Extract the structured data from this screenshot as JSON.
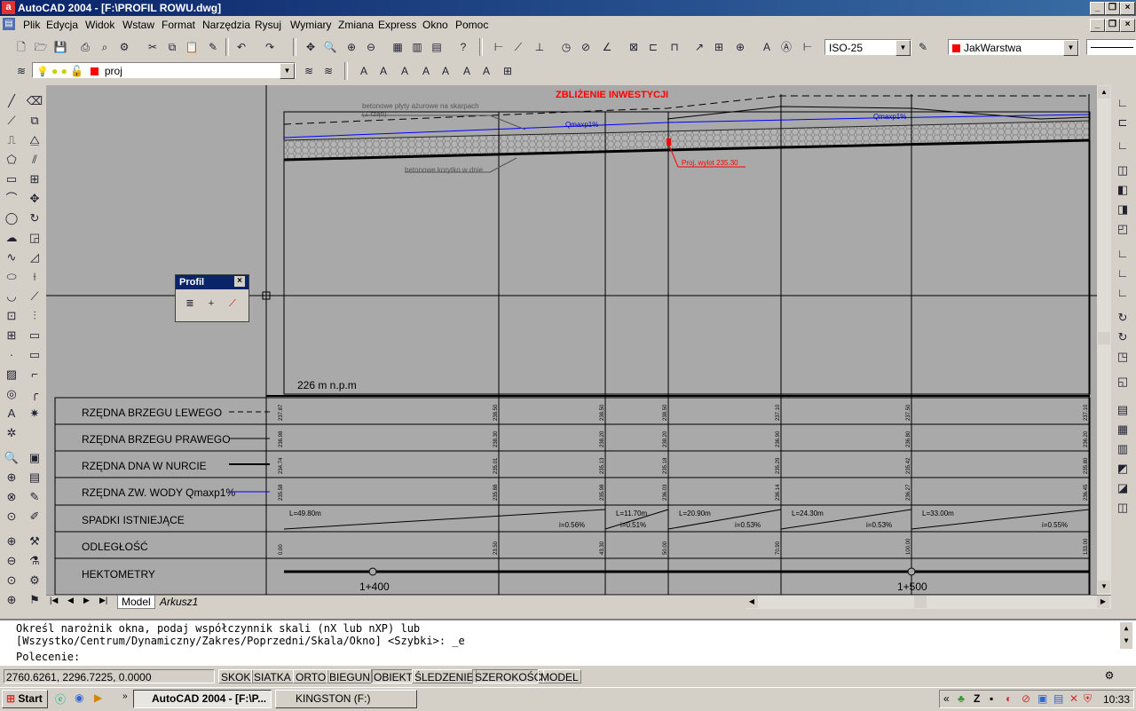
{
  "window": {
    "title": "AutoCAD 2004 - [F:\\PROFIL ROWU.dwg]",
    "app_icon": "a",
    "buttons": [
      "_",
      "❐",
      "×"
    ],
    "doc_buttons": [
      "_",
      "❐",
      "×"
    ]
  },
  "menu": [
    "Plik",
    "Edycja",
    "Widok",
    "Wstaw",
    "Format",
    "Narzędzia",
    "Rysuj",
    "Wymiary",
    "Zmiana",
    "Express",
    "Okno",
    "Pomoc"
  ],
  "toolbar": {
    "dimstyle": "ISO-25",
    "color": "JakWarstwa",
    "color_swatch": "#ff0000",
    "layer": "proj"
  },
  "profil_toolbar": {
    "title": "Profil",
    "close": "×"
  },
  "drawing": {
    "title": "ZBLIŻENIE INWESTYCJI",
    "notes": {
      "plates": "betonowe płyty ażurowe na skarpach",
      "plates_sub": "(1 rząd)",
      "trough": "betonowe korytko w dnie",
      "outlet": "Proj. wylot 235.30",
      "q1": "Qmaxp1%",
      "q2": "Qmaxp1%"
    },
    "datum": "226 m n.p.m",
    "rows": [
      "RZĘDNA BRZEGU LEWEGO",
      "RZĘDNA BRZEGU PRAWEGO",
      "RZĘDNA DNA W NURCIE",
      "RZĘDNA ZW. WODY Qmaxp1%",
      "SPADKI ISTNIEJĄCE",
      "ODLEGŁOŚĆ",
      "HEKTOMETRY"
    ],
    "row_values": [
      [
        "237.87",
        "238.50",
        "238.50",
        "238.50",
        "237.10",
        "237.50",
        "237.10"
      ],
      [
        "236.98",
        "238.30",
        "238.20",
        "238.20",
        "236.90",
        "236.80",
        "236.20"
      ],
      [
        "234.74",
        "235.01",
        "235.13",
        "235.18",
        "235.29",
        "235.42",
        "235.80"
      ],
      [
        "235.58",
        "235.88",
        "235.98",
        "236.03",
        "236.14",
        "236.27",
        "236.45"
      ],
      [
        "0.00",
        "23.50",
        "43.30",
        "50.00",
        "70.90",
        "100.00",
        "133.00"
      ]
    ],
    "slopes": [
      {
        "L": "L=49.80m",
        "i": "i=0.56%"
      },
      {
        "L": "L=11.70m",
        "i": "i=0.51%"
      },
      {
        "L": "L=20.90m",
        "i": "i=0.53%"
      },
      {
        "L": "L=24.30m",
        "i": "i=0.53%"
      },
      {
        "L": "L=33.00m",
        "i": "i=0.55%"
      }
    ],
    "hectometers": [
      "1+400",
      "1+500"
    ]
  },
  "tabs": [
    "Model",
    "Arkusz1"
  ],
  "command": {
    "line1": "Określ narożnik okna, podaj współczynnik skali (nX lub nXP) lub",
    "line2": "[Wszystko/Centrum/Dynamiczny/Zakres/Poprzedni/Skala/Okno] <Szybki>: _e",
    "prompt": "Polecenie:"
  },
  "status": {
    "coords": "2760.6261, 2296.7225, 0.0000",
    "toggles": [
      "SKOK",
      "SIATKA",
      "ORTO",
      "BIEGUN",
      "OBIEKT",
      "ŚLEDZENIE",
      "SZEROKOŚĆ",
      "MODEL"
    ]
  },
  "taskbar": {
    "start": "Start",
    "tasks": [
      "AutoCAD 2004 - [F:\\P...",
      "KINGSTON (F:)"
    ],
    "clock": "10:33",
    "tray_expand": "«"
  }
}
